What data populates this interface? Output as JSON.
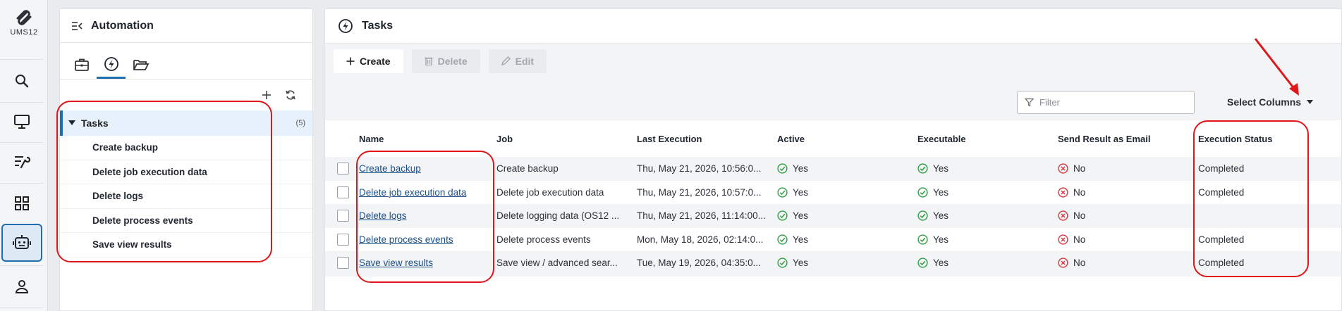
{
  "app": {
    "logo_text": "UMS12"
  },
  "rail": {
    "items": [
      {
        "icon": "search-icon"
      },
      {
        "icon": "monitor-icon"
      },
      {
        "icon": "tools-icon"
      },
      {
        "icon": "apps-icon"
      },
      {
        "icon": "robot-icon",
        "active": true
      },
      {
        "icon": "user-icon"
      }
    ]
  },
  "tree": {
    "title": "Automation",
    "root": {
      "label": "Tasks",
      "count": "(5)"
    },
    "children": [
      "Create backup",
      "Delete job execution data",
      "Delete logs",
      "Delete process events",
      "Save view results"
    ]
  },
  "main": {
    "title": "Tasks",
    "toolbar": {
      "create": "Create",
      "delete": "Delete",
      "edit": "Edit"
    },
    "filter_placeholder": "Filter",
    "select_columns": "Select Columns",
    "columns": [
      "Name",
      "Job",
      "Last Execution",
      "Active",
      "Executable",
      "Send Result as Email",
      "Execution Status"
    ],
    "rows": [
      {
        "name": "Create backup",
        "job": "Create backup",
        "last": "Thu, May 21, 2026, 10:56:0...",
        "active": "Yes",
        "executable": "Yes",
        "email": "No",
        "status": "Completed"
      },
      {
        "name": "Delete job execution data",
        "job": "Delete job execution data",
        "last": "Thu, May 21, 2026, 10:57:0...",
        "active": "Yes",
        "executable": "Yes",
        "email": "No",
        "status": "Completed"
      },
      {
        "name": "Delete logs",
        "job": "Delete logging data (OS12 ...",
        "last": "Thu, May 21, 2026, 11:14:00...",
        "active": "Yes",
        "executable": "Yes",
        "email": "No",
        "status": ""
      },
      {
        "name": "Delete process events",
        "job": "Delete process events",
        "last": "Mon, May 18, 2026, 02:14:0...",
        "active": "Yes",
        "executable": "Yes",
        "email": "No",
        "status": "Completed"
      },
      {
        "name": "Save view results",
        "job": "Save view / advanced sear...",
        "last": "Tue, May 19, 2026, 04:35:0...",
        "active": "Yes",
        "executable": "Yes",
        "email": "No",
        "status": "Completed"
      }
    ]
  },
  "colors": {
    "accent": "#1f6fb0",
    "success": "#2e9e44",
    "error": "#d9363e",
    "annotation": "#e0161b"
  }
}
